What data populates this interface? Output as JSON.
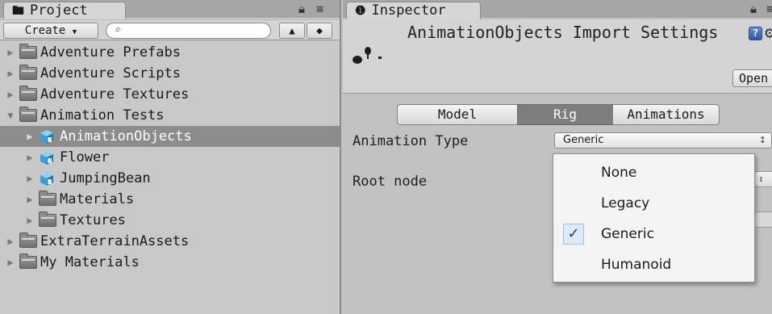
{
  "project": {
    "tab_label": "Project",
    "toolbar": {
      "create_label": "Create",
      "search_value": ""
    },
    "tree": [
      {
        "label": "Adventure Prefabs",
        "type": "folder",
        "depth": 0,
        "expanded": false,
        "selected": false
      },
      {
        "label": "Adventure Scripts",
        "type": "folder",
        "depth": 0,
        "expanded": false,
        "selected": false
      },
      {
        "label": "Adventure Textures",
        "type": "folder",
        "depth": 0,
        "expanded": false,
        "selected": false
      },
      {
        "label": "Animation Tests",
        "type": "folder",
        "depth": 0,
        "expanded": true,
        "selected": false
      },
      {
        "label": "AnimationObjects",
        "type": "model",
        "depth": 1,
        "expanded": false,
        "selected": true
      },
      {
        "label": "Flower",
        "type": "model",
        "depth": 1,
        "expanded": false,
        "selected": false
      },
      {
        "label": "JumpingBean",
        "type": "model",
        "depth": 1,
        "expanded": false,
        "selected": false
      },
      {
        "label": "Materials",
        "type": "folder",
        "depth": 1,
        "expanded": false,
        "selected": false
      },
      {
        "label": "Textures",
        "type": "folder",
        "depth": 1,
        "expanded": false,
        "selected": false
      },
      {
        "label": "ExtraTerrainAssets",
        "type": "folder",
        "depth": 0,
        "expanded": false,
        "selected": false
      },
      {
        "label": "My Materials",
        "type": "folder",
        "depth": 0,
        "expanded": false,
        "selected": false
      }
    ]
  },
  "inspector": {
    "tab_label": "Inspector",
    "title": "AnimationObjects Import Settings",
    "open_label": "Open",
    "tabs": [
      {
        "label": "Model",
        "active": false
      },
      {
        "label": "Rig",
        "active": true
      },
      {
        "label": "Animations",
        "active": false
      }
    ],
    "animation_type_label": "Animation Type",
    "animation_type_value": "Generic",
    "root_node_label": "Root node",
    "dropdown_options": [
      {
        "label": "None",
        "checked": false
      },
      {
        "label": "Legacy",
        "checked": false
      },
      {
        "label": "Generic",
        "checked": true
      },
      {
        "label": "Humanoid",
        "checked": false
      }
    ]
  },
  "icons": {
    "folder": "folder-icon",
    "model": "model-prefab-icon",
    "info": "info-icon",
    "lock": "lock-icon",
    "menu": "panel-menu-icon",
    "help": "help-book-icon",
    "gear": "gear-icon",
    "check": "checkmark-icon"
  },
  "colors": {
    "panel_bg": "#c2c2c2",
    "selected_row": "#8c8c8c",
    "active_segment": "#7d7d7d",
    "cube_blue": "#3a9fd8",
    "checkmark": "#1b3e86"
  }
}
